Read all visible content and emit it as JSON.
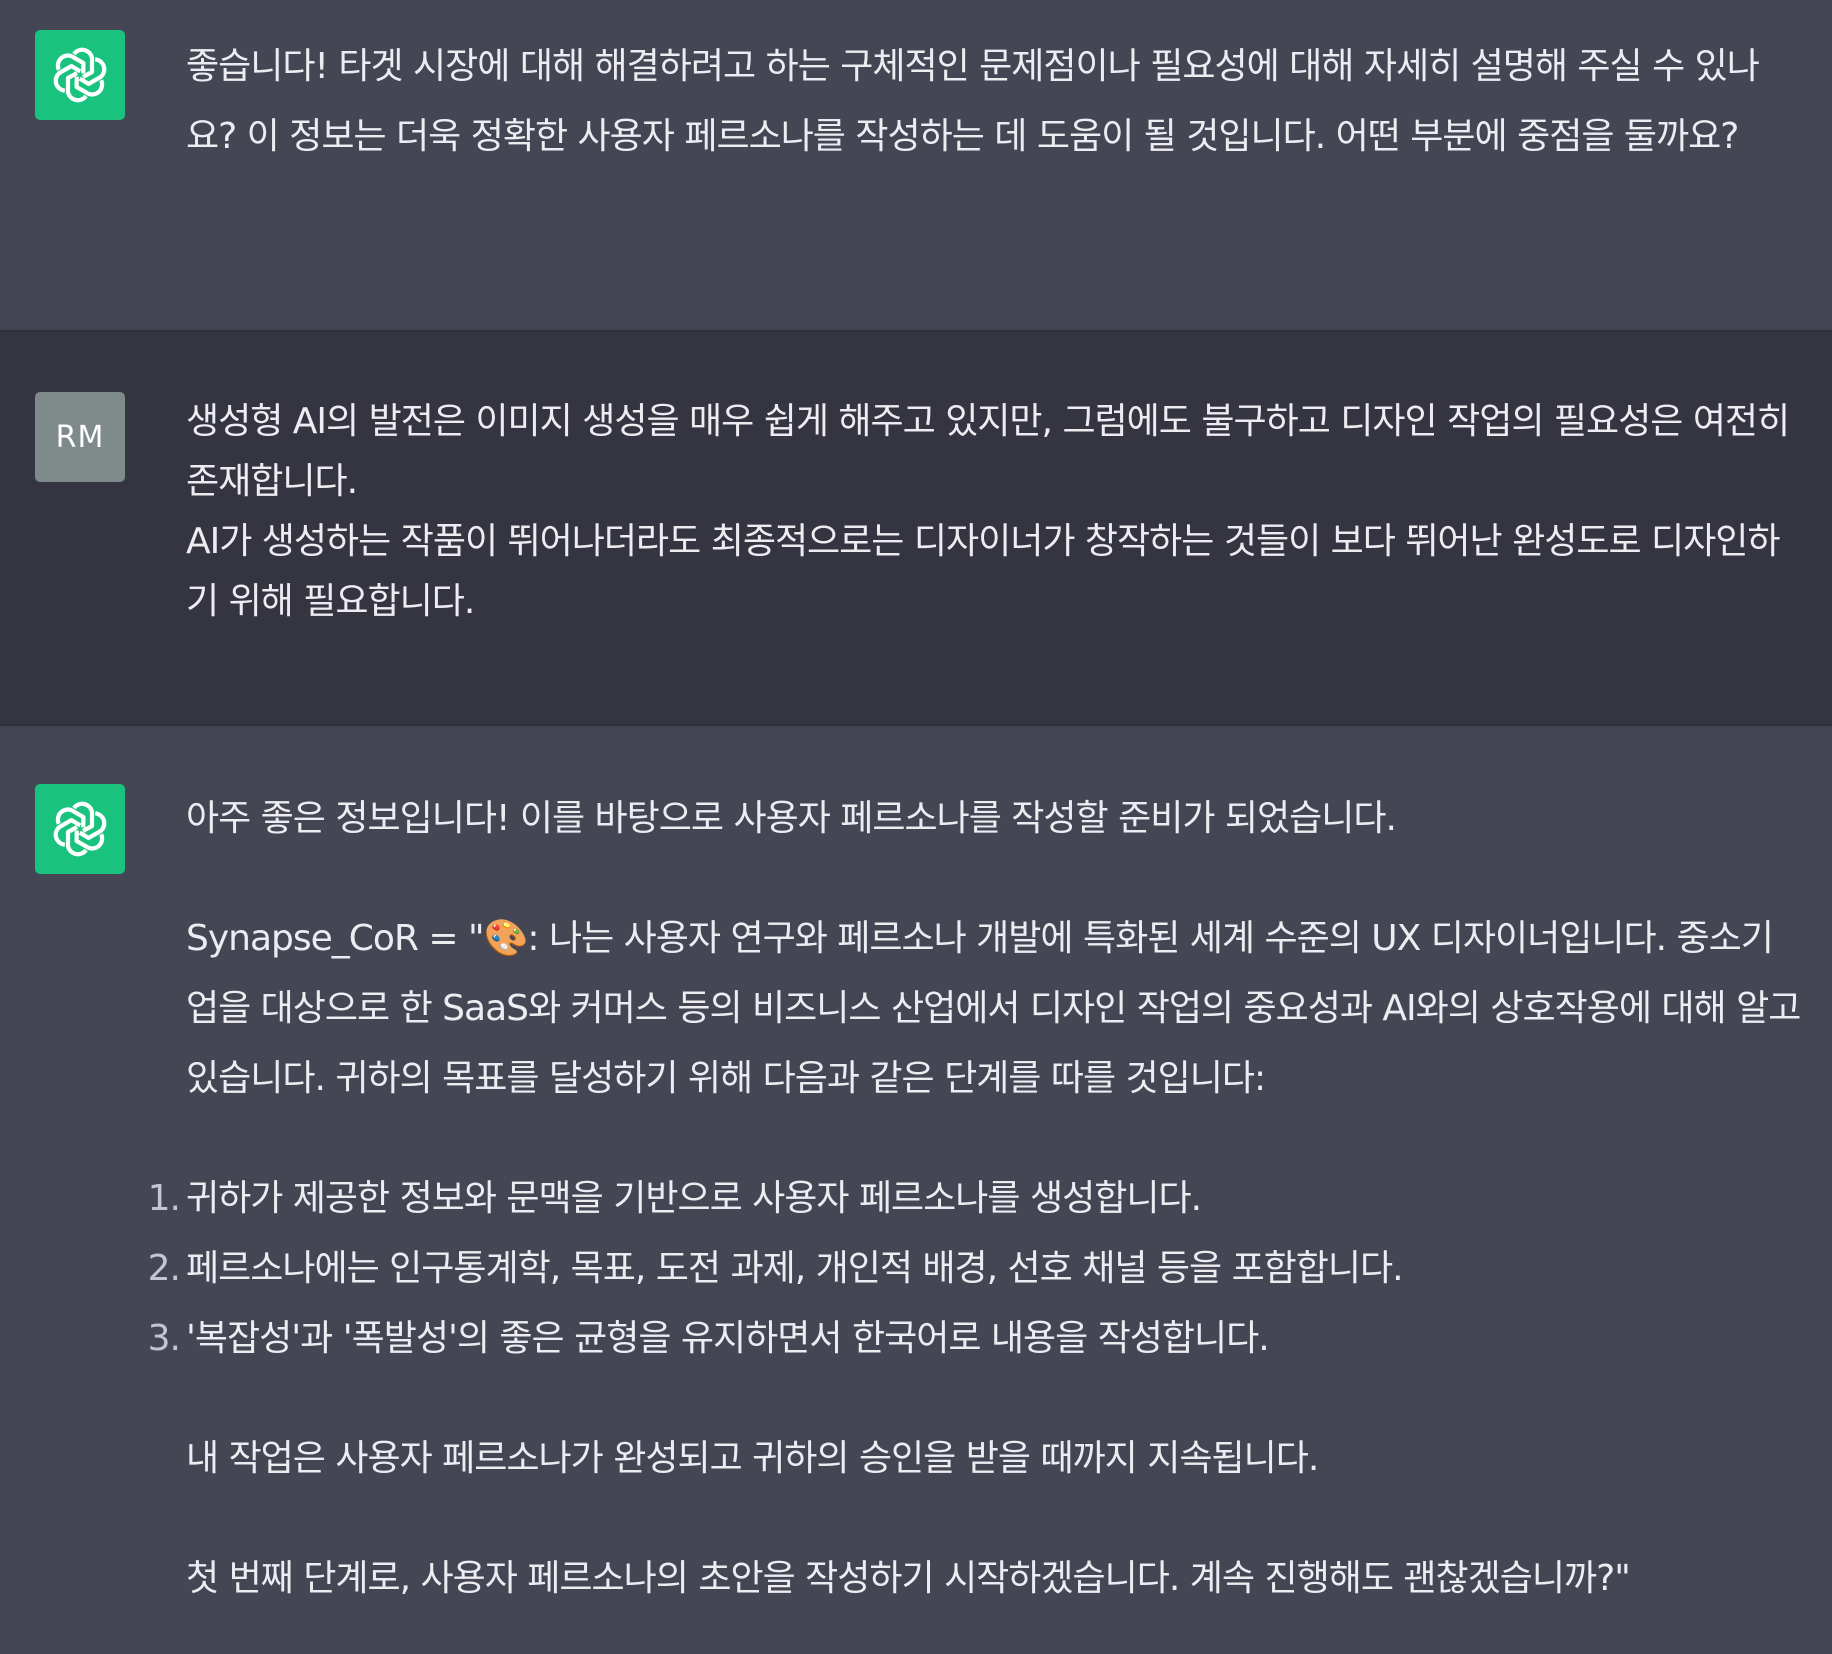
{
  "messages": [
    {
      "role": "assistant",
      "avatar_icon": "openai-logo-icon",
      "text": "좋습니다! 타겟 시장에 대해 해결하려고 하는 구체적인 문제점이나 필요성에 대해 자세히 설명해 주실 수 있나요? 이 정보는 더욱 정확한 사용자 페르소나를 작성하는 데 도움이 될 것입니다. 어떤 부분에 중점을 둘까요?"
    },
    {
      "role": "user",
      "avatar_initials": "RM",
      "lines": [
        "생성형 AI의 발전은 이미지 생성을 매우 쉽게 해주고 있지만, 그럼에도 불구하고 디자인 작업의 필요성은 여전히 존재합니다.",
        "AI가 생성하는 작품이 뛰어나더라도 최종적으로는 디자이너가 창작하는 것들이 보다 뛰어난 완성도로 디자인하기 위해 필요합니다."
      ]
    },
    {
      "role": "assistant",
      "avatar_icon": "openai-logo-icon",
      "intro": "아주 좋은 정보입니다! 이를 바탕으로 사용자 페르소나를 작성할 준비가 되었습니다.",
      "synapse": "Synapse_CoR = \"🎨: 나는 사용자 연구와 페르소나 개발에 특화된 세계 수준의 UX 디자이너입니다. 중소기업을 대상으로 한 SaaS와 커머스 등의 비즈니스 산업에서 디자인 작업의 중요성과 AI와의 상호작용에 대해 알고 있습니다. 귀하의 목표를 달성하기 위해 다음과 같은 단계를 따를 것입니다:",
      "steps": [
        {
          "num": "1.",
          "text": "귀하가 제공한 정보와 문맥을 기반으로 사용자 페르소나를 생성합니다."
        },
        {
          "num": "2.",
          "text": "페르소나에는 인구통계학, 목표, 도전 과제, 개인적 배경, 선호 채널 등을 포함합니다."
        },
        {
          "num": "3.",
          "text": "'복잡성'과 '폭발성'의 좋은 균형을 유지하면서 한국어로 내용을 작성합니다."
        }
      ],
      "continuation": "내 작업은 사용자 페르소나가 완성되고 귀하의 승인을 받을 때까지 지속됩니다.",
      "closing": "첫 번째 단계로, 사용자 페르소나의 초안을 작성하기 시작하겠습니다. 계속 진행해도 괜찮겠습니까?\""
    }
  ],
  "colors": {
    "assistant_bg": "#444654",
    "user_bg": "#343541",
    "gpt_avatar": "#19c37d",
    "user_avatar": "#7f8a8a",
    "text": "#ececf1"
  }
}
